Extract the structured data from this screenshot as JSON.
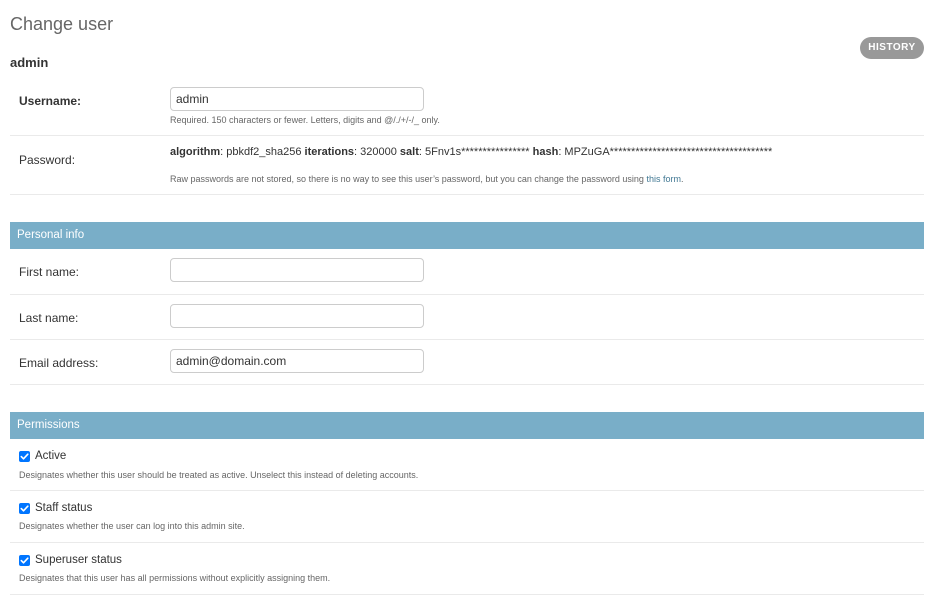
{
  "header": {
    "title": "Change user",
    "history_label": "HISTORY",
    "object_name": "admin"
  },
  "account": {
    "username_label": "Username:",
    "username_value": "admin",
    "username_help": "Required. 150 characters or fewer. Letters, digits and @/./+/-/_ only.",
    "password_label": "Password:",
    "password": {
      "algorithm_label": "algorithm",
      "algorithm_value": ": pbkdf2_sha256 ",
      "iterations_label": "iterations",
      "iterations_value": ": 320000 ",
      "salt_label": "salt",
      "salt_value": ": 5Fnv1s**************** ",
      "hash_label": "hash",
      "hash_value": ": MPZuGA**************************************"
    },
    "password_help": "Raw passwords are not stored, so there is no way to see this user’s password, but you can change the password using ",
    "password_link": "this form",
    "password_help_end": "."
  },
  "personal_info": {
    "title": "Personal info",
    "first_name_label": "First name:",
    "first_name_value": "",
    "last_name_label": "Last name:",
    "last_name_value": "",
    "email_label": "Email address:",
    "email_value": "admin@domain.com"
  },
  "permissions": {
    "title": "Permissions",
    "items": [
      {
        "label": "Active",
        "checked": true,
        "help": "Designates whether this user should be treated as active. Unselect this instead of deleting accounts."
      },
      {
        "label": "Staff status",
        "checked": true,
        "help": "Designates whether the user can log into this admin site."
      },
      {
        "label": "Superuser status",
        "checked": true,
        "help": "Designates that this user has all permissions without explicitly assigning them."
      }
    ]
  },
  "colors": {
    "section_header": "#79aec8",
    "history_button": "#999999",
    "link": "#417893",
    "checkbox": "#0075ff"
  }
}
